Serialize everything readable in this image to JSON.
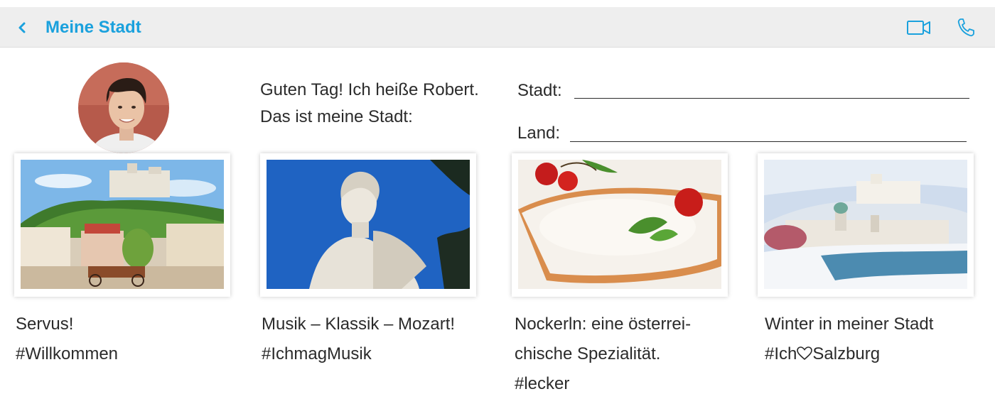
{
  "header": {
    "back_label": "<",
    "title": "Meine Stadt",
    "icons": [
      "video-camera-icon",
      "phone-icon"
    ],
    "accent_color": "#1aa1dd"
  },
  "intro": {
    "line1": "Guten Tag! Ich heiße Robert.",
    "line2": "Das ist meine Stadt:"
  },
  "form": {
    "city_label": "Stadt:",
    "country_label": "Land:"
  },
  "posts": [
    {
      "line1": "Servus!",
      "line2": "#Willkommen",
      "line3": ""
    },
    {
      "line1": "Musik – Klassik – Mozart!",
      "line2": "#IchmagMusik",
      "line3": ""
    },
    {
      "line1": "Nockerln: eine österrei-",
      "line2": "chische Spezialität.",
      "line3": "#lecker"
    },
    {
      "line1": "Winter in meiner Stadt",
      "line2_prefix": "#Ich",
      "line2_suffix": "Salzburg",
      "line3": ""
    }
  ]
}
